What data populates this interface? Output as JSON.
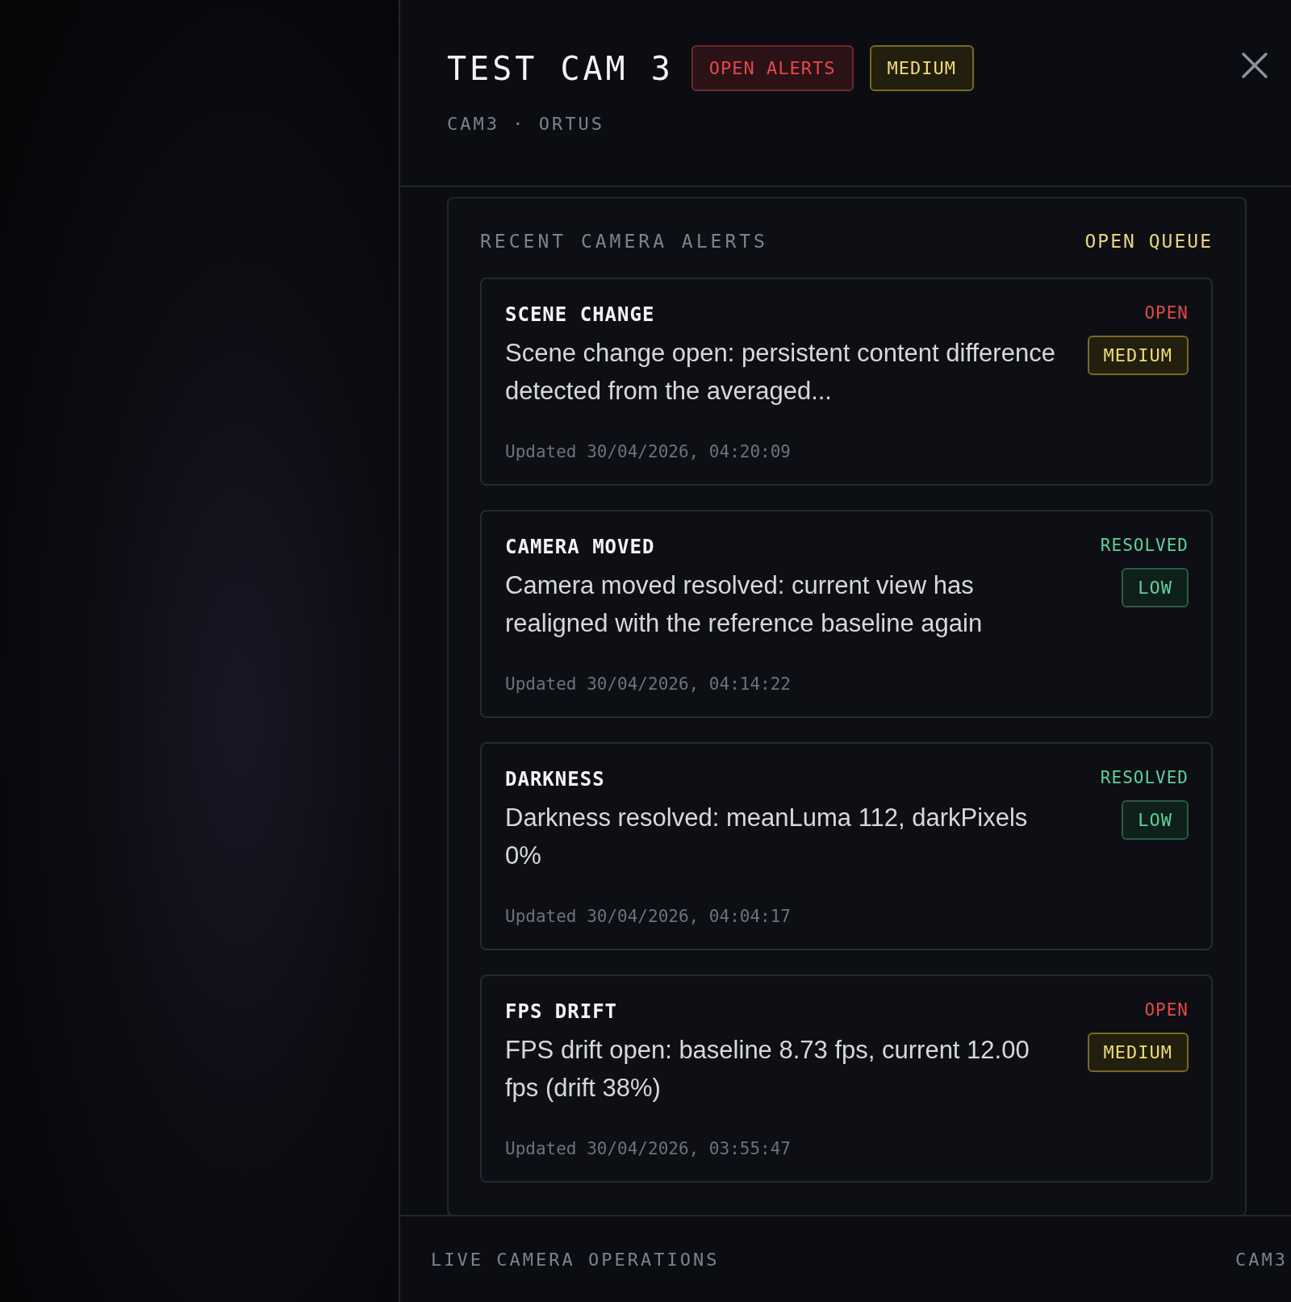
{
  "title": "TEST CAM 3",
  "badges": [
    {
      "label": "OPEN ALERTS",
      "kind": "alert"
    },
    {
      "label": "MEDIUM",
      "kind": "medium"
    }
  ],
  "subtitle": "CAM3 · ORTUS",
  "section": {
    "title": "RECENT CAMERA ALERTS",
    "action": "OPEN QUEUE"
  },
  "alerts": [
    {
      "type": "SCENE CHANGE",
      "status": {
        "label": "OPEN",
        "kind": "open"
      },
      "severity": {
        "label": "MEDIUM",
        "kind": "medium"
      },
      "description": "Scene change open: persistent content difference detected from the averaged...",
      "updated": "Updated 30/04/2026, 04:20:09"
    },
    {
      "type": "CAMERA MOVED",
      "status": {
        "label": "RESOLVED",
        "kind": "resolved"
      },
      "severity": {
        "label": "LOW",
        "kind": "low"
      },
      "description": "Camera moved resolved: current view has realigned with the reference baseline again",
      "updated": "Updated 30/04/2026, 04:14:22"
    },
    {
      "type": "DARKNESS",
      "status": {
        "label": "RESOLVED",
        "kind": "resolved"
      },
      "severity": {
        "label": "LOW",
        "kind": "low"
      },
      "description": "Darkness resolved: meanLuma 112, darkPixels 0%",
      "updated": "Updated 30/04/2026, 04:04:17"
    },
    {
      "type": "FPS DRIFT",
      "status": {
        "label": "OPEN",
        "kind": "open"
      },
      "severity": {
        "label": "MEDIUM",
        "kind": "medium"
      },
      "description": "FPS drift open: baseline 8.73 fps, current 12.00 fps (drift 38%)",
      "updated": "Updated 30/04/2026, 03:55:47"
    }
  ],
  "footer": {
    "left": "LIVE CAMERA OPERATIONS",
    "right": "CAM3"
  }
}
